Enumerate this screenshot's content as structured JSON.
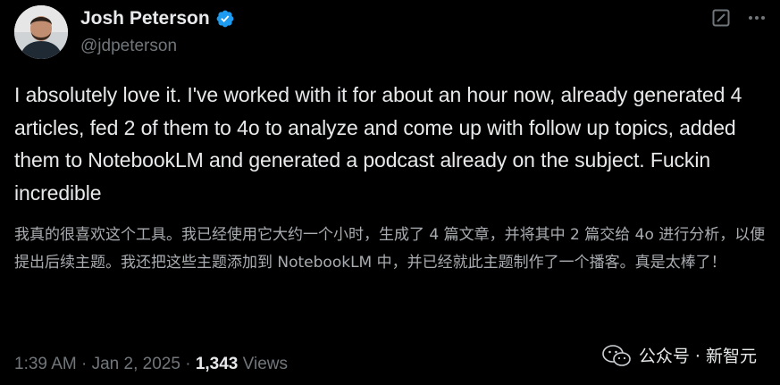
{
  "author": {
    "display_name": "Josh Peterson",
    "handle": "@jdpeterson",
    "verified": true,
    "avatar_icon": "avatar-photo"
  },
  "actions": {
    "grok_icon": "grok-icon",
    "more_icon": "more-icon"
  },
  "tweet": {
    "text": "I absolutely love it. I've worked with it for about an hour now, already generated 4 articles, fed 2 of them to 4o to analyze and come up with follow up topics, added them to NotebookLM and generated a podcast already on the subject. Fuckin incredible",
    "translation": "我真的很喜欢这个工具。我已经使用它大约一个小时，生成了 4 篇文章，并将其中 2 篇交给 4o 进行分析，以便提出后续主题。我还把这些主题添加到 NotebookLM 中，并已经就此主题制作了一个播客。真是太棒了！"
  },
  "meta": {
    "time": "1:39 AM",
    "separator": "·",
    "date": "Jan 2, 2025",
    "views_count": "1,343",
    "views_label": "Views"
  },
  "watermark": {
    "text": "公众号 · 新智元",
    "icon": "wechat-icon"
  },
  "colors": {
    "background": "#000000",
    "primary_text": "#e7e9ea",
    "secondary_text": "#71767b",
    "verified_blue": "#1d9bf0"
  }
}
